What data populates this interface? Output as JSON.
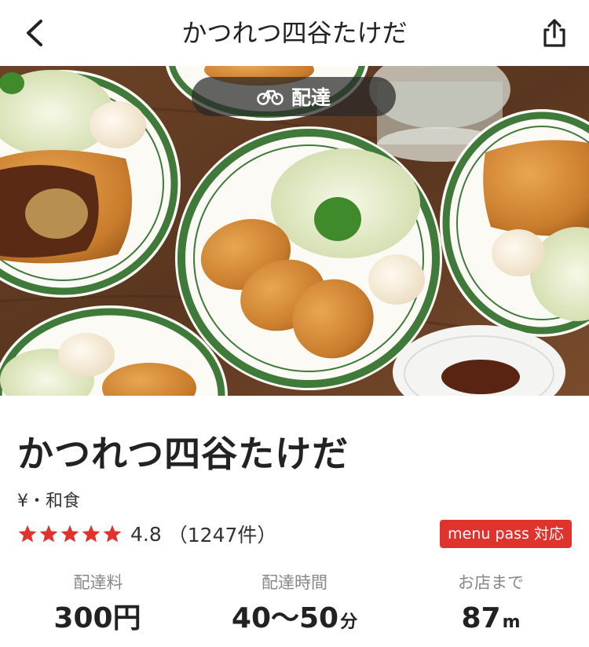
{
  "header": {
    "title": "かつれつ四谷たけだ",
    "back_icon": "chevron-left-icon",
    "share_icon": "share-icon"
  },
  "hero": {
    "delivery_label": "配達",
    "delivery_icon": "bicycle-icon"
  },
  "store": {
    "name": "かつれつ四谷たけだ",
    "category": "¥・和食",
    "rating": "4.8",
    "review_count": "（1247件）",
    "stars": 5,
    "badge": "menu pass 対応"
  },
  "stats": [
    {
      "label": "配達料",
      "value": "300円",
      "unit": ""
    },
    {
      "label": "配達時間",
      "value": "40〜50",
      "unit": "分"
    },
    {
      "label": "お店まで",
      "value": "87",
      "unit": "m"
    }
  ],
  "colors": {
    "accent": "#e0332e",
    "star": "#e0332e",
    "plate_rim": "#3f7a3a"
  }
}
